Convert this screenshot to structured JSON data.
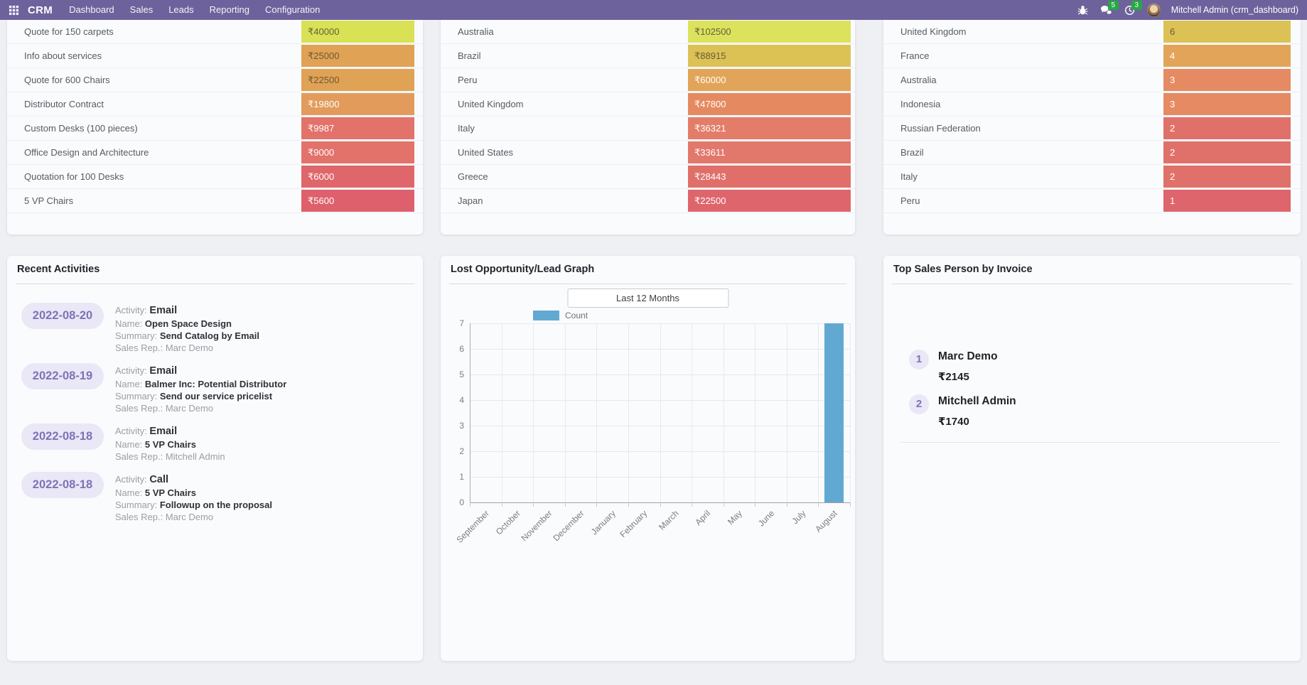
{
  "theme": {
    "nav_bg": "#6e629c",
    "badge_bg": "#28a745",
    "pill_bg": "#eae7f6",
    "pill_fg": "#7d73b6",
    "bar_color": "#62a9d2",
    "card_bg": "#fafbfd",
    "page_bg": "#eff0f4"
  },
  "navbar": {
    "app_name": "CRM",
    "menu_items": [
      "Dashboard",
      "Sales",
      "Leads",
      "Reporting",
      "Configuration"
    ],
    "message_badge": "5",
    "activity_badge": "3",
    "user_name": "Mitchell Admin (crm_dashboard)"
  },
  "top_tables": [
    {
      "name": "opportunities-by-revenue",
      "rows": [
        {
          "label": "Quote for 150 carpets",
          "value": "₹40000",
          "bg": "#d9e154",
          "fg": "#60623f"
        },
        {
          "label": "Info about services",
          "value": "₹25000",
          "bg": "#e0a254",
          "fg": "#6b5a3b"
        },
        {
          "label": "Quote for 600 Chairs",
          "value": "₹22500",
          "bg": "#e0a254",
          "fg": "#6b5a3b"
        },
        {
          "label": "Distributor Contract",
          "value": "₹19800",
          "bg": "#e29b5b",
          "fg": "#ffffff"
        },
        {
          "label": "Custom Desks (100 pieces)",
          "value": "₹9987",
          "bg": "#e2726a",
          "fg": "#ffffff"
        },
        {
          "label": "Office Design and Architecture",
          "value": "₹9000",
          "bg": "#e2726a",
          "fg": "#ffffff"
        },
        {
          "label": "Quotation for 100 Desks",
          "value": "₹6000",
          "bg": "#df666b",
          "fg": "#ffffff"
        },
        {
          "label": "5 VP Chairs",
          "value": "₹5600",
          "bg": "#de606c",
          "fg": "#ffffff"
        }
      ]
    },
    {
      "name": "revenue-by-country",
      "rows": [
        {
          "label": "Australia",
          "value": "₹102500",
          "bg": "#dce25c",
          "fg": "#5f6240"
        },
        {
          "label": "Brazil",
          "value": "₹88915",
          "bg": "#dcc255",
          "fg": "#675c38"
        },
        {
          "label": "Peru",
          "value": "₹60000",
          "bg": "#e2a458",
          "fg": "#ffffff"
        },
        {
          "label": "United Kingdom",
          "value": "₹47800",
          "bg": "#e58a60",
          "fg": "#ffffff"
        },
        {
          "label": "Italy",
          "value": "₹36321",
          "bg": "#e37d6a",
          "fg": "#ffffff"
        },
        {
          "label": "United States",
          "value": "₹33611",
          "bg": "#e2786b",
          "fg": "#ffffff"
        },
        {
          "label": "Greece",
          "value": "₹28443",
          "bg": "#e06f6a",
          "fg": "#ffffff"
        },
        {
          "label": "Japan",
          "value": "₹22500",
          "bg": "#df656c",
          "fg": "#ffffff"
        }
      ]
    },
    {
      "name": "leads-count-by-country",
      "rows": [
        {
          "label": "United Kingdom",
          "value": "6",
          "bg": "#dcc255",
          "fg": "#635a39"
        },
        {
          "label": "France",
          "value": "4",
          "bg": "#e2a458",
          "fg": "#ffffff"
        },
        {
          "label": "Australia",
          "value": "3",
          "bg": "#e58a62",
          "fg": "#ffffff"
        },
        {
          "label": "Indonesia",
          "value": "3",
          "bg": "#e58a62",
          "fg": "#ffffff"
        },
        {
          "label": "Russian Federation",
          "value": "2",
          "bg": "#e0716a",
          "fg": "#ffffff"
        },
        {
          "label": "Brazil",
          "value": "2",
          "bg": "#e0716a",
          "fg": "#ffffff"
        },
        {
          "label": "Italy",
          "value": "2",
          "bg": "#e0716a",
          "fg": "#ffffff"
        },
        {
          "label": "Peru",
          "value": "1",
          "bg": "#de656b",
          "fg": "#ffffff"
        }
      ]
    }
  ],
  "recent_activities": {
    "title": "Recent Activities",
    "items": [
      {
        "date": "2022-08-20",
        "lines": [
          {
            "label": "Activity:",
            "value": "Email",
            "muted": false,
            "big": true
          },
          {
            "label": "Name:",
            "value": "Open Space Design",
            "muted": false
          },
          {
            "label": "Summary:",
            "value": "Send Catalog by Email",
            "muted": false
          },
          {
            "label": "Sales Rep.:",
            "value": "Marc Demo",
            "muted": true
          }
        ]
      },
      {
        "date": "2022-08-19",
        "lines": [
          {
            "label": "Activity:",
            "value": "Email",
            "muted": false,
            "big": true
          },
          {
            "label": "Name:",
            "value": "Balmer Inc: Potential Distributor",
            "muted": false
          },
          {
            "label": "Summary:",
            "value": "Send our service pricelist",
            "muted": false
          },
          {
            "label": "Sales Rep.:",
            "value": "Marc Demo",
            "muted": true
          }
        ]
      },
      {
        "date": "2022-08-18",
        "lines": [
          {
            "label": "Activity:",
            "value": "Email",
            "muted": false,
            "big": true
          },
          {
            "label": "Name:",
            "value": "5 VP Chairs",
            "muted": false
          },
          {
            "label": "Sales Rep.:",
            "value": "Mitchell Admin",
            "muted": true
          }
        ]
      },
      {
        "date": "2022-08-18",
        "lines": [
          {
            "label": "Activity:",
            "value": "Call",
            "muted": false,
            "big": true
          },
          {
            "label": "Name:",
            "value": "5 VP Chairs",
            "muted": false
          },
          {
            "label": "Summary:",
            "value": "Followup on the proposal",
            "muted": false
          },
          {
            "label": "Sales Rep.:",
            "value": "Marc Demo",
            "muted": true
          }
        ]
      }
    ]
  },
  "chart_card": {
    "title": "Lost Opportunity/Lead Graph",
    "filter_value": "Last 12 Months",
    "legend": "Count"
  },
  "chart_data": {
    "type": "bar",
    "title": "Lost Opportunity/Lead Graph",
    "categories": [
      "September",
      "October",
      "November",
      "December",
      "January",
      "February",
      "March",
      "April",
      "May",
      "June",
      "July",
      "August"
    ],
    "series": [
      {
        "name": "Count",
        "values": [
          0,
          0,
          0,
          0,
          0,
          0,
          0,
          0,
          0,
          0,
          0,
          7
        ]
      }
    ],
    "ylim": [
      0,
      7
    ],
    "ytick_step": 1,
    "grid": true,
    "legend_position": "top",
    "bar_color": "#62a9d2"
  },
  "top_sales": {
    "title": "Top Sales Person by Invoice",
    "items": [
      {
        "rank": "1",
        "name": "Marc Demo",
        "amount": "₹2145"
      },
      {
        "rank": "2",
        "name": "Mitchell Admin",
        "amount": "₹1740"
      }
    ]
  }
}
